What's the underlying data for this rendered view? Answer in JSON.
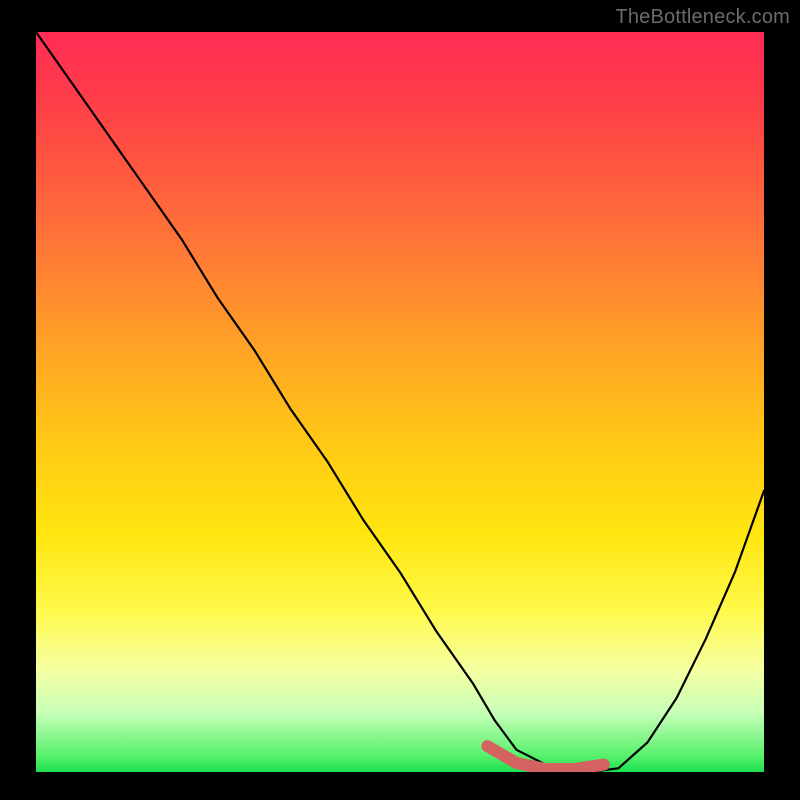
{
  "watermark": "TheBottleneck.com",
  "chart_data": {
    "type": "line",
    "title": "",
    "xlabel": "",
    "ylabel": "",
    "xlim": [
      0,
      100
    ],
    "ylim": [
      0,
      100
    ],
    "grid": false,
    "legend": false,
    "series": [
      {
        "name": "curve",
        "color": "#000000",
        "x": [
          0,
          5,
          10,
          15,
          20,
          25,
          30,
          35,
          40,
          45,
          50,
          55,
          60,
          63,
          66,
          70,
          73,
          76,
          80,
          84,
          88,
          92,
          96,
          100
        ],
        "values": [
          100,
          93,
          86,
          79,
          72,
          64,
          57,
          49,
          42,
          34,
          27,
          19,
          12,
          7,
          3,
          1,
          0,
          0,
          0.5,
          4,
          10,
          18,
          27,
          38
        ]
      },
      {
        "name": "min-segment",
        "color": "#d46260",
        "x": [
          62,
          66,
          70,
          74,
          78
        ],
        "values": [
          3.5,
          1.2,
          0.4,
          0.4,
          1.0
        ]
      }
    ],
    "annotations": []
  }
}
